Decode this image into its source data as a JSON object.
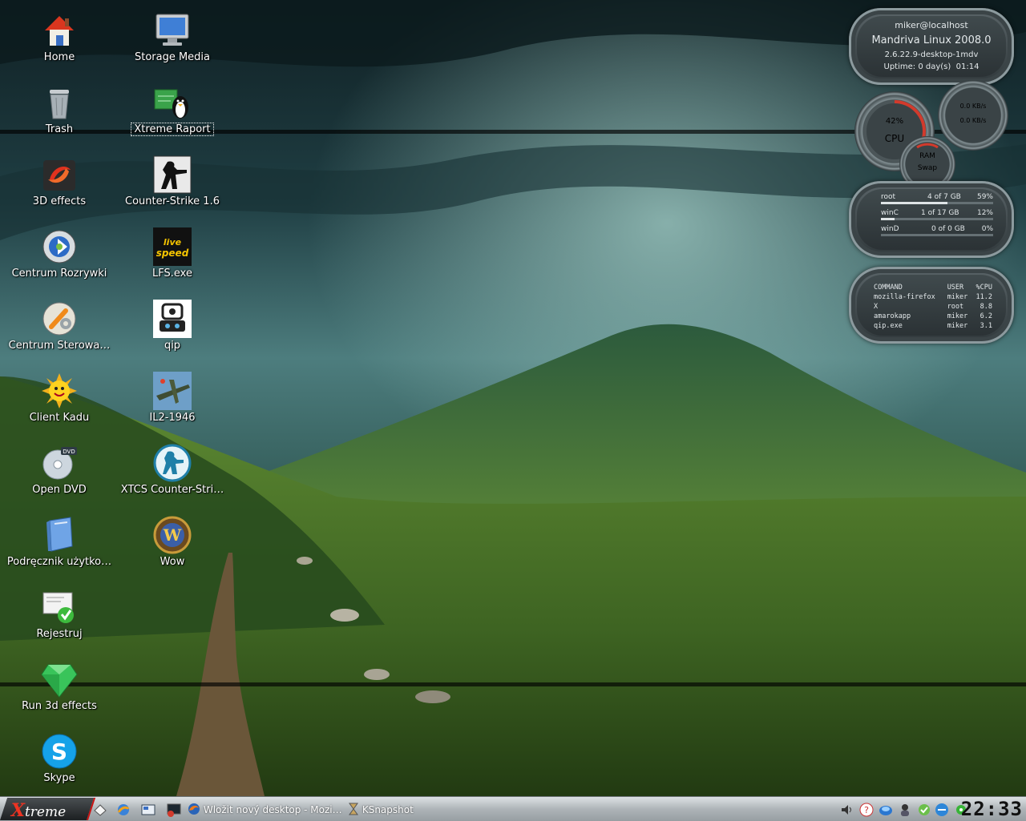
{
  "desktop": {
    "icons": [
      {
        "label": "Home",
        "icon": "home-icon"
      },
      {
        "label": "Trash",
        "icon": "trash-icon"
      },
      {
        "label": "3D effects",
        "icon": "3d-effects-icon"
      },
      {
        "label": "Centrum Rozrywki",
        "icon": "media-center-icon"
      },
      {
        "label": "Centrum Sterowa…",
        "icon": "control-center-icon"
      },
      {
        "label": "Client Kadu",
        "icon": "kadu-sun-icon"
      },
      {
        "label": "Open DVD",
        "icon": "dvd-icon"
      },
      {
        "label": "Podręcznik użytko…",
        "icon": "manual-book-icon"
      },
      {
        "label": "Rejestruj",
        "icon": "register-icon"
      },
      {
        "label": "Run 3d effects",
        "icon": "diamond-icon"
      },
      {
        "label": "Skype",
        "icon": "skype-icon"
      },
      {
        "label": "Storage Media",
        "icon": "monitor-icon"
      },
      {
        "label": "Xtreme Raport",
        "icon": "tux-report-icon"
      },
      {
        "label": "Counter-Strike 1.6",
        "icon": "counter-strike-icon"
      },
      {
        "label": "LFS.exe",
        "icon": "lfs-icon"
      },
      {
        "label": "qip",
        "icon": "qip-icon"
      },
      {
        "label": "IL2-1946",
        "icon": "il2-plane-icon"
      },
      {
        "label": "XTCS Counter-Stri…",
        "icon": "xtcs-icon"
      },
      {
        "label": "Wow",
        "icon": "wow-icon"
      }
    ]
  },
  "sysinfo": {
    "user": "miker@localhost",
    "os": "Mandriva Linux 2008.0",
    "kernel": "2.6.22.9-desktop-1mdv",
    "uptime_label": "Uptime:",
    "uptime_value": "0 day(s)  01:14"
  },
  "cpu": {
    "percent_label": "42%",
    "percent": 42,
    "label": "CPU"
  },
  "net": {
    "up": "0.0 KB/s",
    "down": "0.0 KB/s"
  },
  "mem": {
    "ram": "RAM",
    "swap": "Swap"
  },
  "disks": [
    {
      "name": "root",
      "usage": "4 of 7 GB",
      "pct": "59%",
      "fraction": 0.59
    },
    {
      "name": "winC",
      "usage": "1 of 17 GB",
      "pct": "12%",
      "fraction": 0.12
    },
    {
      "name": "winD",
      "usage": "0 of 0 GB",
      "pct": "0%",
      "fraction": 0
    }
  ],
  "procs": {
    "headers": [
      "COMMAND",
      "USER",
      "%CPU"
    ],
    "rows": [
      [
        "mozilla-firefox",
        "miker",
        "11.2"
      ],
      [
        "X",
        "root",
        "8.8"
      ],
      [
        "amarokapp",
        "miker",
        "6.2"
      ],
      [
        "qip.exe",
        "miker",
        "3.1"
      ]
    ]
  },
  "taskbar": {
    "menu_x": "X",
    "menu_text": "treme",
    "tasks": [
      {
        "label": "Wložit nový desktop - Mozi…",
        "icon": "firefox-icon"
      },
      {
        "label": "KSnapshot",
        "icon": "ksnapshot-icon"
      }
    ],
    "clock": "22:33"
  },
  "colors": {
    "accent": "#cc1111",
    "widget": "#3b4447",
    "text": "#ffffff"
  }
}
